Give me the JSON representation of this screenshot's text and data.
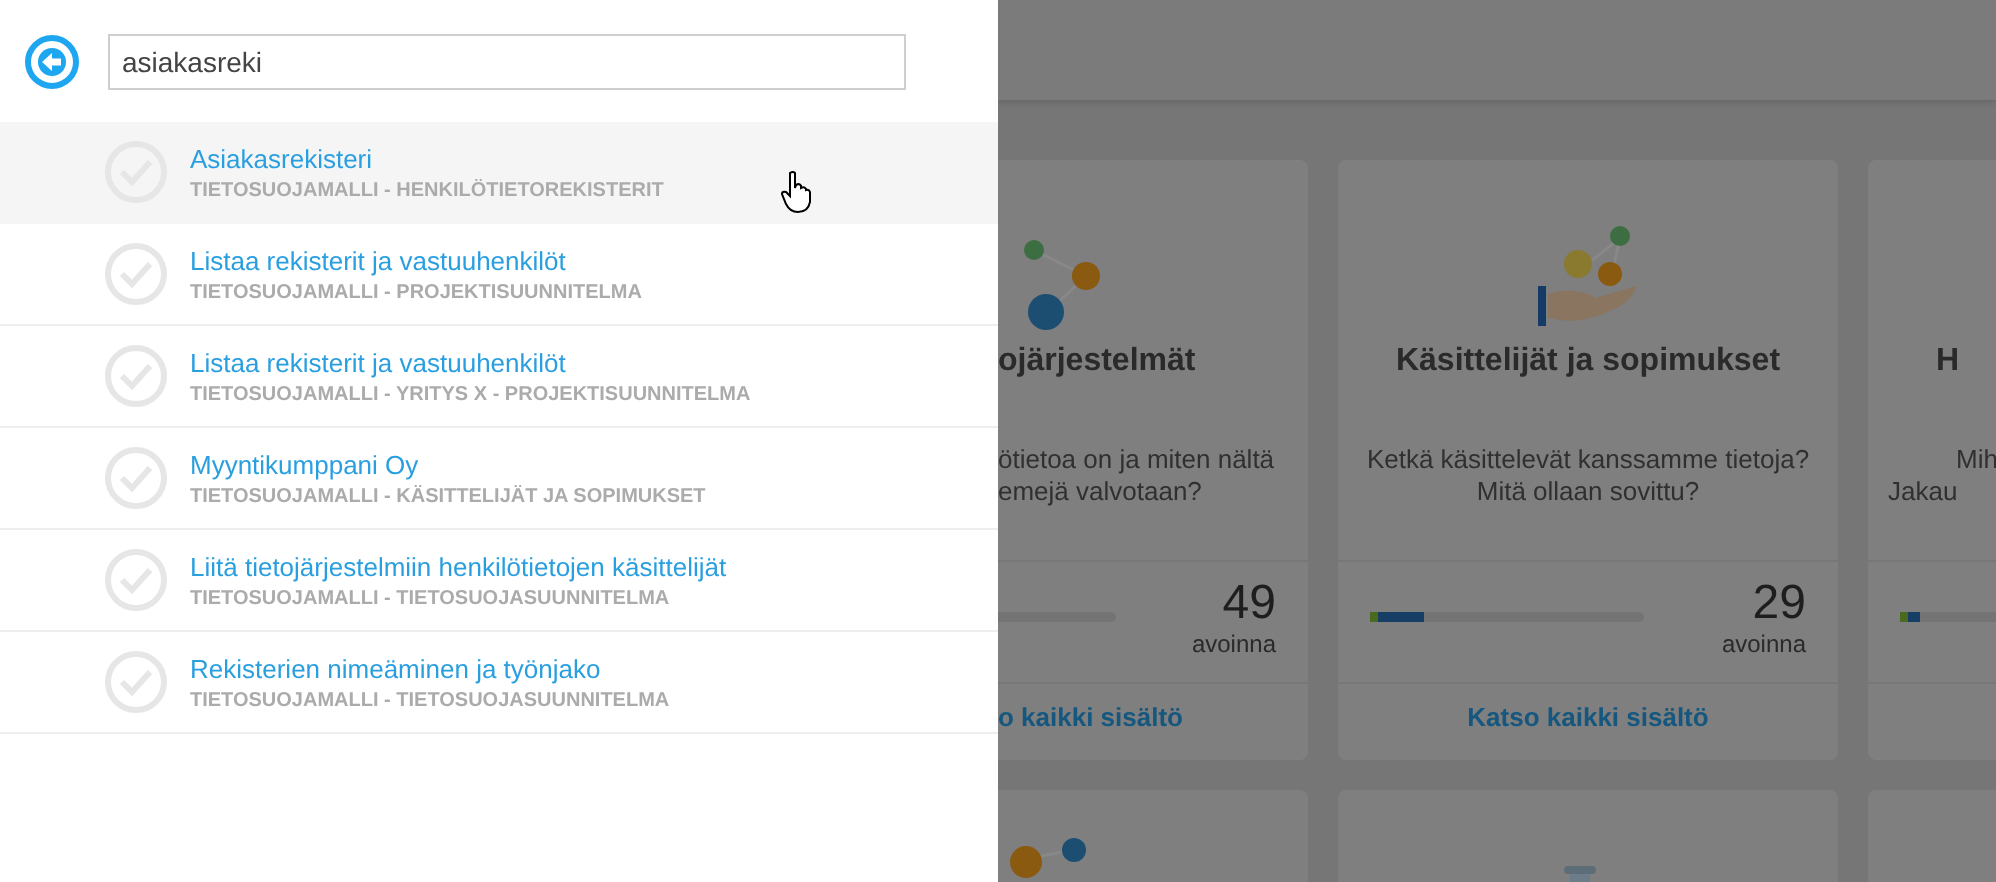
{
  "search": {
    "value": "asiakasreki"
  },
  "results": [
    {
      "title": "Asiakasrekisteri",
      "path": "TIETOSUOJAMALLI - HENKILÖTIETOREKISTERIT",
      "selected": true
    },
    {
      "title": "Listaa rekisterit ja vastuuhenkilöt",
      "path": "TIETOSUOJAMALLI - PROJEKTISUUNNITELMA",
      "selected": false
    },
    {
      "title": "Listaa rekisterit ja vastuuhenkilöt",
      "path": "TIETOSUOJAMALLI - YRITYS X - PROJEKTISUUNNITELMA",
      "selected": false
    },
    {
      "title": "Myyntikumppani Oy",
      "path": "TIETOSUOJAMALLI - KÄSITTELIJÄT JA SOPIMUKSET",
      "selected": false
    },
    {
      "title": "Liitä tietojärjestelmiin henkilötietojen käsittelijät",
      "path": "TIETOSUOJAMALLI - TIETOSUOJASUUNNITELMA",
      "selected": false
    },
    {
      "title": "Rekisterien nimeäminen ja työnjako",
      "path": "TIETOSUOJAMALLI - TIETOSUOJASUUNNITELMA",
      "selected": false
    }
  ],
  "cards": [
    {
      "kind": "cut-left",
      "title": "ojärjestelmät",
      "description": [
        "ötietoa on ja miten nältä",
        "emejä valvotaan?"
      ],
      "count": "49",
      "count_label": "avoinna",
      "link": "o kaikki sisältö"
    },
    {
      "kind": "full",
      "title": "Käsittelijät ja sopimukset",
      "description": [
        "Ketkä käsittelevät kanssamme tietoja?",
        "Mitä ollaan sovittu?"
      ],
      "level": 0.2,
      "count": "29",
      "count_label": "avoinna",
      "link": "Katso kaikki sisältö"
    },
    {
      "kind": "cut-right",
      "title": "H",
      "description": [
        "Mih",
        "Jakau"
      ],
      "level": 0.07
    }
  ]
}
